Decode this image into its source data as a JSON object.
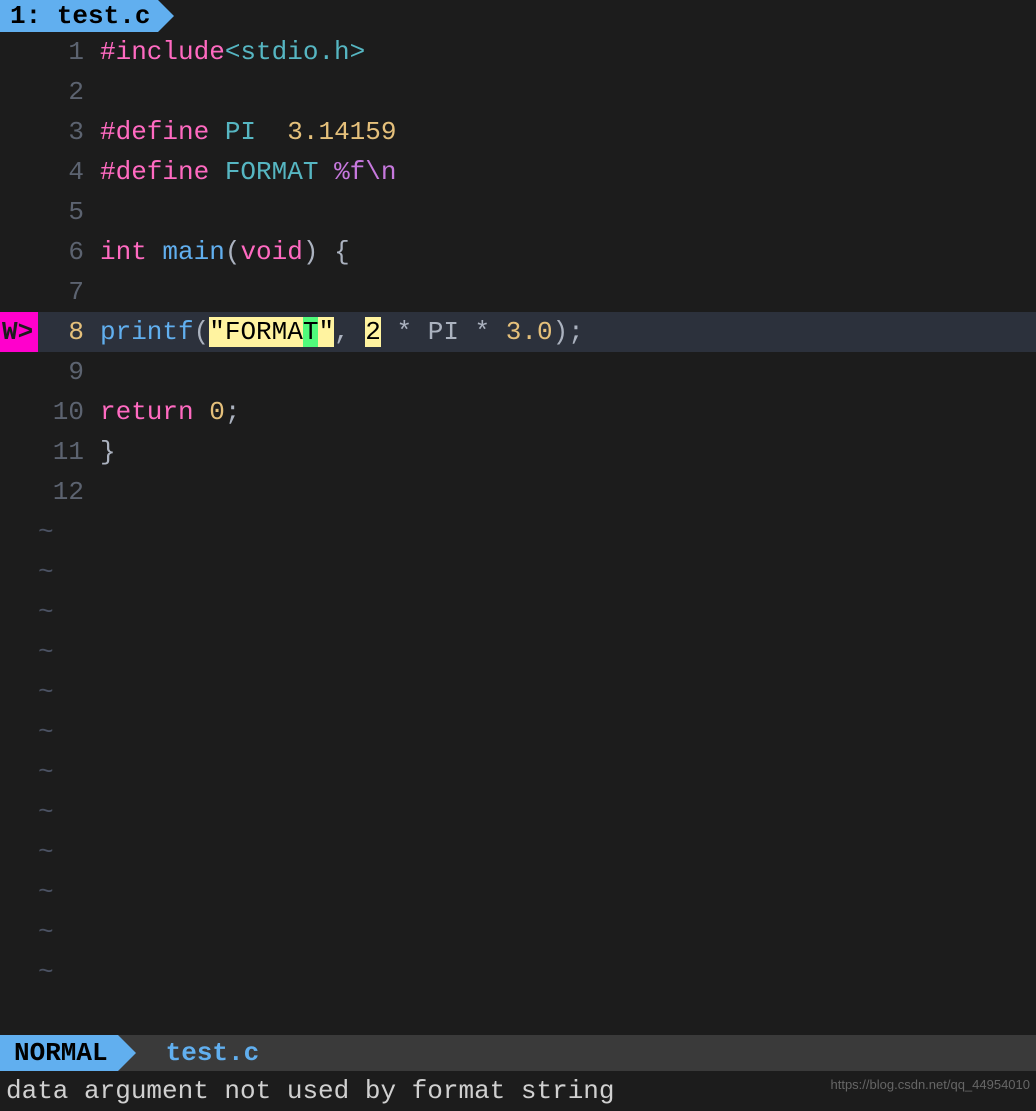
{
  "tab": {
    "index": "1:",
    "filename": "test.c"
  },
  "gutter": {
    "sign_warning": "W>",
    "line_numbers": [
      "1",
      "2",
      "3",
      "4",
      "5",
      "6",
      "7",
      "8",
      "9",
      "10",
      "11",
      "12"
    ],
    "current_line": 8,
    "tilde": "~"
  },
  "code": {
    "l1": {
      "pp": "#include",
      "hdr": "<stdio.h>"
    },
    "l3": {
      "pp": "#define",
      "mac": "PI",
      "val": "3.14159"
    },
    "l4": {
      "pp": "#define",
      "mac": "FORMAT",
      "fmt": "%f",
      "esc": "\\n"
    },
    "l6": {
      "ty": "int",
      "fn": "main",
      "void": "void",
      "brace": "{"
    },
    "l8": {
      "fn": "printf",
      "lp": "(",
      "q1": "\"",
      "str_hl": "FORMA",
      "str_cursor": "T",
      "q2": "\"",
      "comma": ",",
      "two_hl": "2",
      "star1": " * ",
      "pi": "PI",
      "star2": " * ",
      "three": "3.0",
      "rp": ")",
      "semi": ";"
    },
    "l10": {
      "kw": "return",
      "zero": "0",
      "semi": ";"
    },
    "l11": {
      "brace": "}"
    }
  },
  "statusline": {
    "mode": "NORMAL",
    "filename": "test.c"
  },
  "message": "data argument not used by format string",
  "watermark": "https://blog.csdn.net/qq_44954010"
}
